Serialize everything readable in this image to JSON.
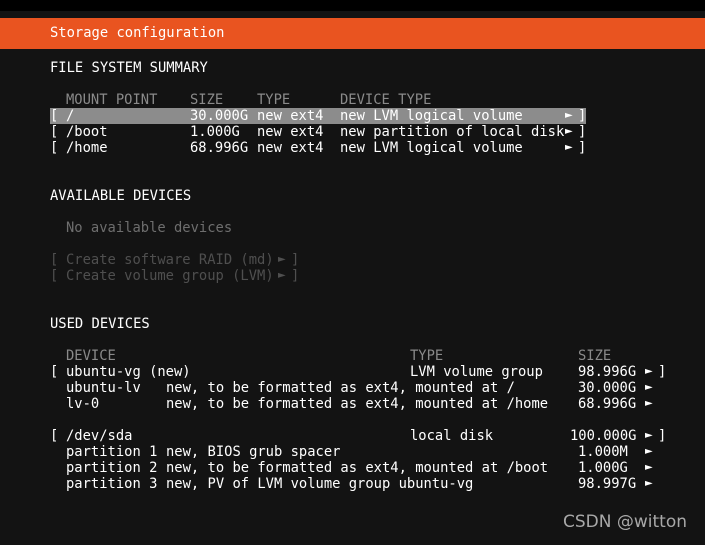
{
  "header": {
    "title": "Storage configuration",
    "accent_color": "#e95420",
    "background_color": "#131313",
    "text_color": "#ffffff",
    "dim_text_color": "#6e6e6e",
    "disabled_text_color": "#4f4f4f",
    "highlight_color": "#8c8c8c"
  },
  "icons": {
    "expand_arrow": "►",
    "bracket_open": "[",
    "bracket_close": "]"
  },
  "filesystem_summary": {
    "section_label": "FILE SYSTEM SUMMARY",
    "columns": [
      "MOUNT POINT",
      "SIZE",
      "TYPE",
      "DEVICE TYPE"
    ],
    "rows": [
      {
        "mount_point": "/",
        "size": "30.000G",
        "type": "new ext4",
        "device_type": "new LVM logical volume",
        "selected": true
      },
      {
        "mount_point": "/boot",
        "size": "1.000G",
        "type": "new ext4",
        "device_type": "new partition of local disk",
        "selected": false
      },
      {
        "mount_point": "/home",
        "size": "68.996G",
        "type": "new ext4",
        "device_type": "new LVM logical volume",
        "selected": false
      }
    ]
  },
  "available_devices": {
    "section_label": "AVAILABLE DEVICES",
    "empty_message": "No available devices",
    "actions": [
      {
        "label": "Create software RAID (md)",
        "enabled": false
      },
      {
        "label": "Create volume group (LVM)",
        "enabled": false
      }
    ]
  },
  "used_devices": {
    "section_label": "USED DEVICES",
    "columns": [
      "DEVICE",
      "TYPE",
      "SIZE"
    ],
    "groups": [
      {
        "device": "ubuntu-vg (new)",
        "type": "LVM volume group",
        "size": "98.996G",
        "children": [
          {
            "name": "ubuntu-lv",
            "description": "new, to be formatted as ext4, mounted at /",
            "size": "30.000G"
          },
          {
            "name": "lv-0",
            "description": "new, to be formatted as ext4, mounted at /home",
            "size": "68.996G"
          }
        ]
      },
      {
        "device": "/dev/sda",
        "type": "local disk",
        "size": "100.000G",
        "children": [
          {
            "name": "partition 1",
            "description": "new, BIOS grub spacer",
            "size": "1.000M"
          },
          {
            "name": "partition 2",
            "description": "new, to be formatted as ext4, mounted at /boot",
            "size": "1.000G"
          },
          {
            "name": "partition 3",
            "description": "new, PV of LVM volume group ubuntu-vg",
            "size": "98.997G"
          }
        ]
      }
    ]
  },
  "watermark": {
    "text": "CSDN @witton"
  }
}
